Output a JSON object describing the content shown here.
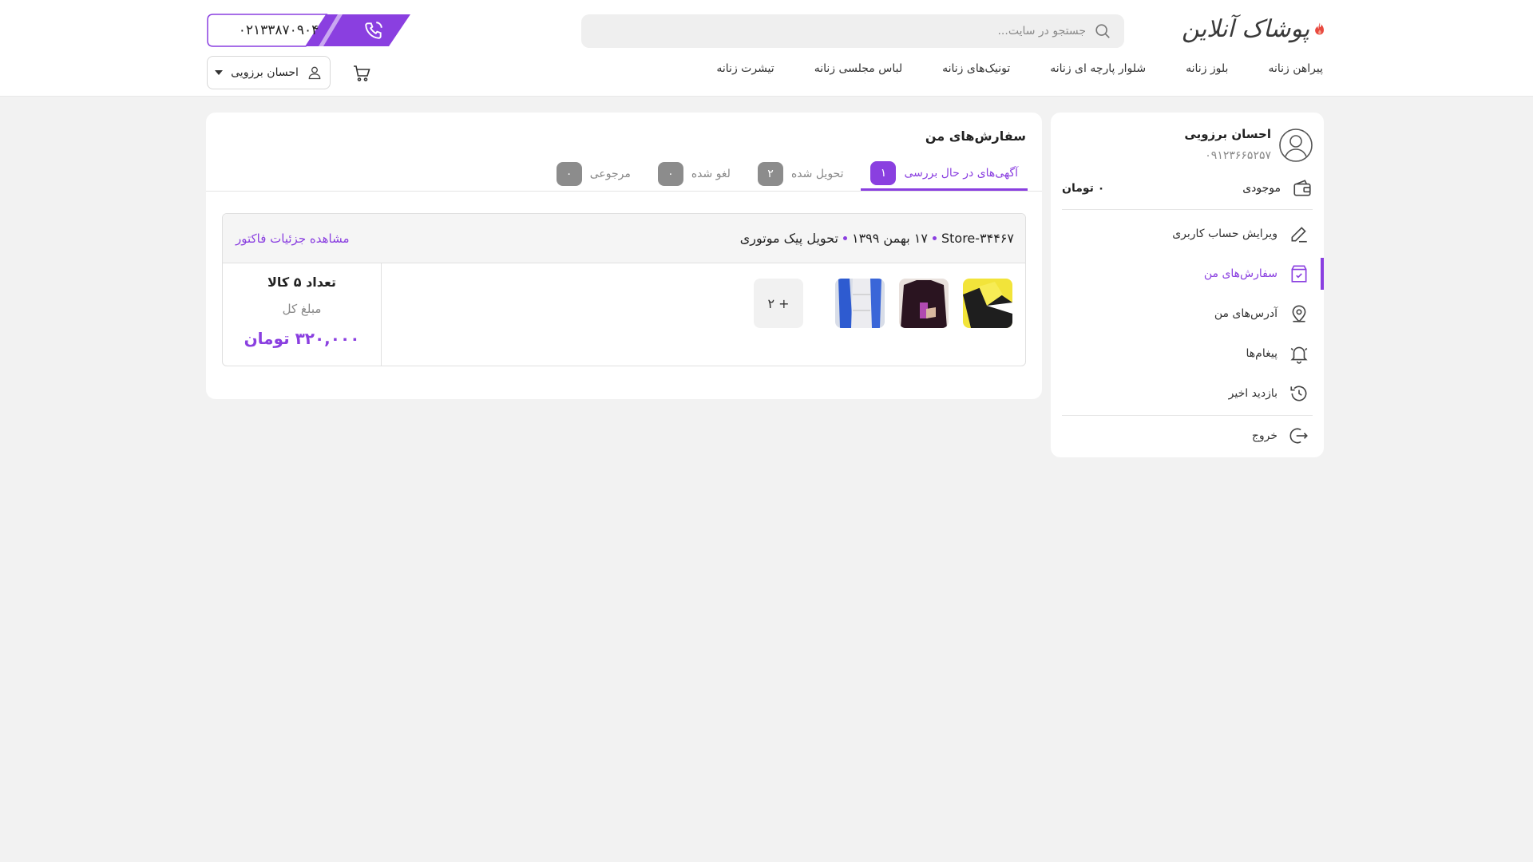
{
  "brand": {
    "logo_text": "پوشاک آنلاین"
  },
  "search": {
    "placeholder": "جستجو در سایت..."
  },
  "support": {
    "phone": "۰۲۱۳۳۸۷۰۹۰۴"
  },
  "nav": {
    "items": [
      {
        "label": "پیراهن زنانه"
      },
      {
        "label": "بلوز زنانه"
      },
      {
        "label": "شلوار پارچه ای زنانه"
      },
      {
        "label": "تونیک‌های زنانه"
      },
      {
        "label": "لباس مجلسی زنانه"
      },
      {
        "label": "تیشرت زنانه"
      }
    ]
  },
  "header_user": {
    "name": "احسان برزویی"
  },
  "sidebar": {
    "name": "احسان برزویی",
    "mobile": "۰۹۱۲۳۶۶۵۲۵۷",
    "balance_label": "موجودی",
    "balance_value": "۰ تومان",
    "items": [
      {
        "label": "ویرایش حساب کاربری",
        "icon": "edit-icon"
      },
      {
        "label": "سفارش‌های من",
        "icon": "orders-bag-icon",
        "active": true
      },
      {
        "label": "آدرس‌های من",
        "icon": "location-pin-icon"
      },
      {
        "label": "پیغام‌ها",
        "icon": "bell-icon"
      },
      {
        "label": "بازدید اخیر",
        "icon": "history-icon"
      },
      {
        "label": "خروج",
        "icon": "logout-icon"
      }
    ]
  },
  "orders": {
    "title": "سفارش‌های من",
    "tabs": [
      {
        "label": "آگهی‌های در حال بررسی",
        "count": "۱",
        "active": true
      },
      {
        "label": "تحویل شده",
        "count": "۲"
      },
      {
        "label": "لغو شده",
        "count": "۰"
      },
      {
        "label": "مرجوعی",
        "count": "۰"
      }
    ],
    "order": {
      "code": "Store-۳۴۴۶۷",
      "date": "۱۷ بهمن ۱۳۹۹",
      "shipping": "تحویل پیک موتوری",
      "details_link": "مشاهده جزئیات فاکتور",
      "more_items": "+ ۲",
      "item_count": "تعداد ۵ کالا",
      "total_label": "مبلغ کل",
      "total_value": "۳۲۰,۰۰۰ تومان"
    }
  },
  "colors": {
    "accent": "#8a3fe0",
    "background": "#f2f2f2",
    "logo_flame": "#e8493f"
  }
}
